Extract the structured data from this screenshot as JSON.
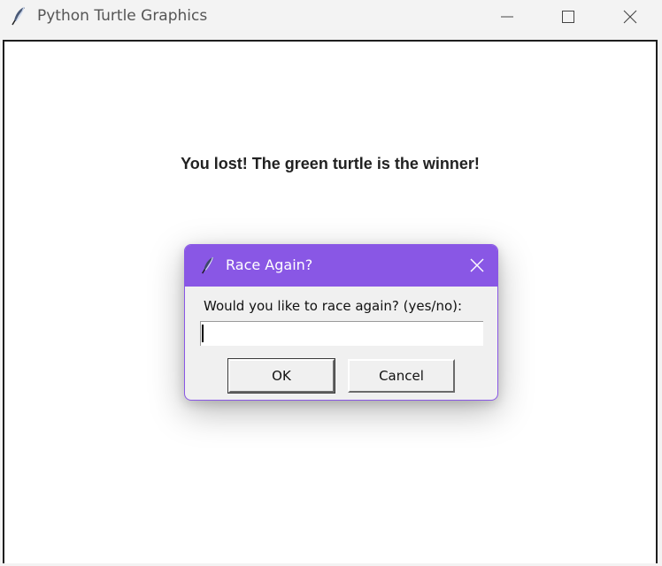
{
  "window": {
    "title": "Python Turtle Graphics",
    "app_icon": "feather-icon",
    "controls": [
      "minimize-icon",
      "maximize-icon",
      "close-icon"
    ]
  },
  "canvas": {
    "message": "You lost! The green turtle is the winner!"
  },
  "dialog": {
    "title": "Race Again?",
    "prompt": "Would you like to race again? (yes/no):",
    "input_value": "",
    "ok_label": "OK",
    "cancel_label": "Cancel",
    "accent_color": "#8957e5"
  }
}
